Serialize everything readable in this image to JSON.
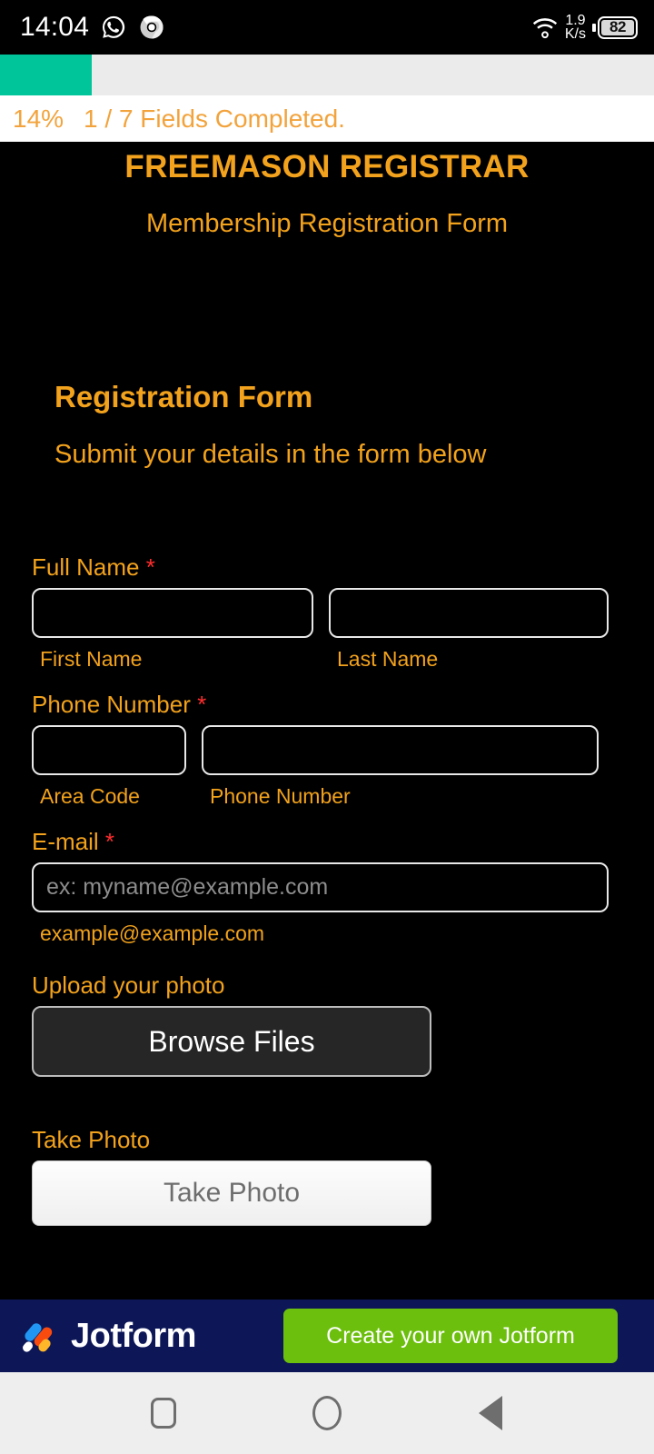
{
  "status_bar": {
    "time": "14:04",
    "whatsapp_icon": "whatsapp-icon",
    "chrome_icon": "chrome-icon",
    "wifi_icon": "wifi-icon",
    "network_speed_value": "1.9",
    "network_speed_unit": "K/s",
    "battery_level": "82"
  },
  "progress": {
    "percent_label": "14%",
    "percent_value": 14,
    "fields_label": "1 / 7 Fields Completed.",
    "fill_color": "#00c49a",
    "track_color": "#ebebeb",
    "text_color": "#f2a33c"
  },
  "form": {
    "org_title": "FREEMASON REGISTRAR",
    "org_subtitle": "Membership Registration Form",
    "section_title": "Registration Form",
    "section_subtitle": "Submit your details in the form below",
    "accent_color": "#f2a21c",
    "required_color": "#ff2d2d",
    "background_color": "#000000",
    "fields": {
      "full_name": {
        "label": "Full Name",
        "required_mark": "*",
        "first": {
          "value": "",
          "placeholder": "",
          "sublabel": "First Name"
        },
        "last": {
          "value": "",
          "placeholder": "",
          "sublabel": "Last Name"
        }
      },
      "phone": {
        "label": "Phone Number",
        "required_mark": "*",
        "area": {
          "value": "",
          "placeholder": "",
          "sublabel": "Area Code"
        },
        "number": {
          "value": "",
          "placeholder": "",
          "sublabel": "Phone Number"
        }
      },
      "email": {
        "label": "E-mail",
        "required_mark": "*",
        "value": "",
        "placeholder": "ex: myname@example.com",
        "sublabel": "example@example.com"
      },
      "upload_photo": {
        "label": "Upload your photo",
        "button_label": "Browse Files"
      },
      "take_photo": {
        "label": "Take Photo",
        "button_label": "Take Photo"
      }
    }
  },
  "footer": {
    "brand_name": "Jotform",
    "logo_icon": "jotform-logo-icon",
    "cta_label": "Create your own Jotform",
    "background_color": "#0d1758",
    "cta_color": "#6cbf0c"
  },
  "navbar": {
    "recents_icon": "recents-square-icon",
    "home_icon": "home-circle-icon",
    "back_icon": "back-triangle-icon"
  }
}
